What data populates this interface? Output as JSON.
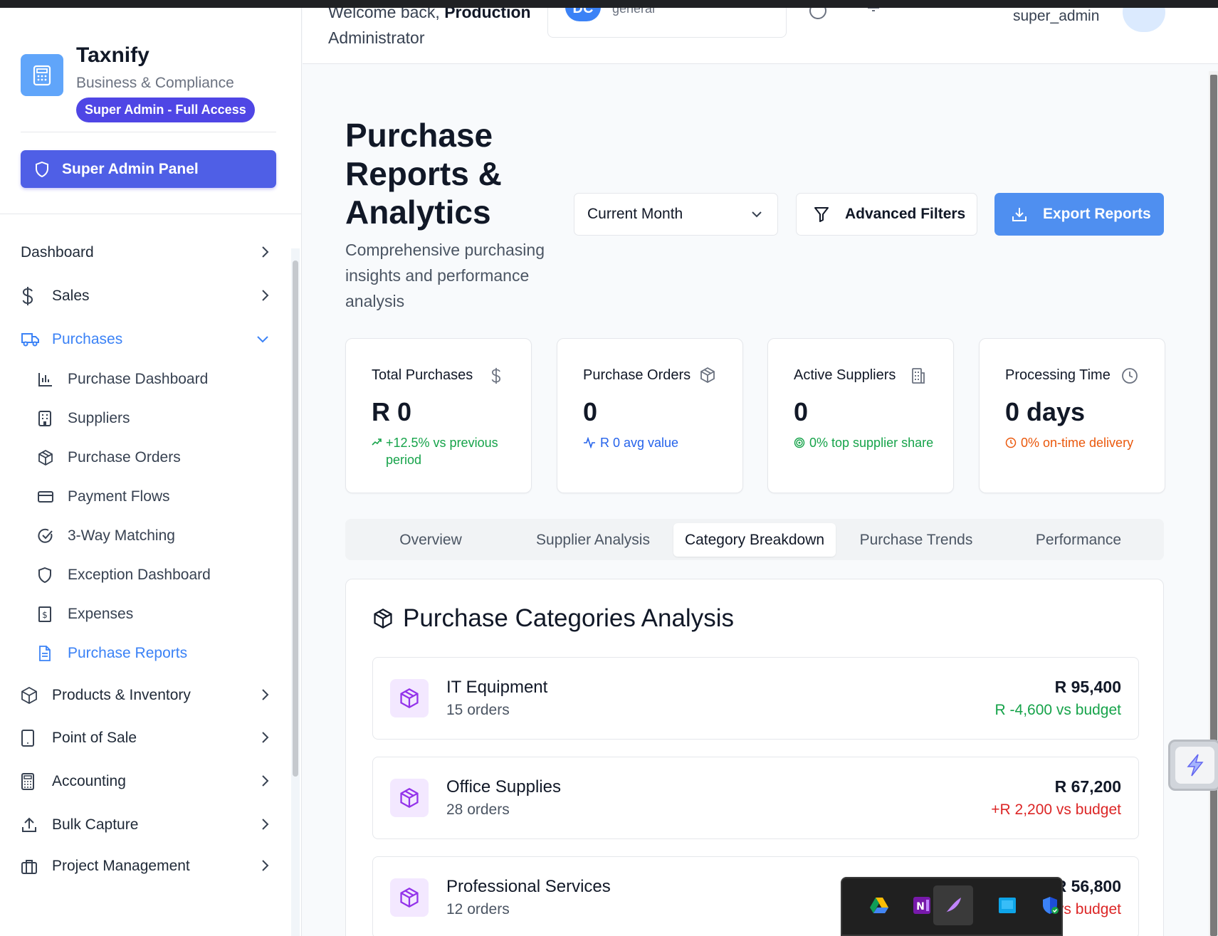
{
  "app": {
    "name": "Taxnify",
    "subtitle": "Business & Compliance",
    "role_badge": "Super Admin - Full Access",
    "admin_panel_label": "Super Admin Panel"
  },
  "header": {
    "welcome_prefix": "Welcome back,",
    "welcome_name": "Production",
    "welcome_name_line2": "Administrator",
    "company_avatar": "DC",
    "company_name": "general",
    "user_name": "super_admin"
  },
  "sidebar": {
    "items": [
      {
        "label": "Dashboard",
        "icon": "none"
      },
      {
        "label": "Sales",
        "icon": "dollar-icon"
      },
      {
        "label": "Purchases",
        "icon": "truck-icon",
        "expanded": true
      },
      {
        "label": "Products & Inventory",
        "icon": "box-icon"
      },
      {
        "label": "Point of Sale",
        "icon": "tablet-icon"
      },
      {
        "label": "Accounting",
        "icon": "calculator-icon"
      },
      {
        "label": "Bulk Capture",
        "icon": "upload-icon"
      },
      {
        "label": "Project Management",
        "icon": "briefcase-icon"
      }
    ],
    "subitems": [
      {
        "label": "Purchase Dashboard",
        "icon": "bar-chart-icon"
      },
      {
        "label": "Suppliers",
        "icon": "building-icon"
      },
      {
        "label": "Purchase Orders",
        "icon": "package-icon"
      },
      {
        "label": "Payment Flows",
        "icon": "credit-card-icon"
      },
      {
        "label": "3-Way Matching",
        "icon": "check-circle-icon"
      },
      {
        "label": "Exception Dashboard",
        "icon": "shield-icon"
      },
      {
        "label": "Expenses",
        "icon": "receipt-icon"
      },
      {
        "label": "Purchase Reports",
        "icon": "file-text-icon",
        "active": true
      }
    ]
  },
  "page": {
    "title": "Purchase Reports & Analytics",
    "subtitle": "Comprehensive purchasing insights and performance analysis",
    "period_select": "Current Month",
    "filters_label": "Advanced Filters",
    "export_label": "Export Reports"
  },
  "stats": [
    {
      "label": "Total Purchases",
      "value": "R 0",
      "note": "+12.5% vs previous period",
      "color": "#16a34a",
      "icon": "dollar-icon"
    },
    {
      "label": "Purchase Orders",
      "value": "0",
      "note": "R 0 avg value",
      "color": "#2563eb",
      "icon": "package-icon"
    },
    {
      "label": "Active Suppliers",
      "value": "0",
      "note": "0% top supplier share",
      "color": "#16a34a",
      "icon": "building-icon"
    },
    {
      "label": "Processing Time",
      "value": "0 days",
      "note": "0% on-time delivery",
      "color": "#ea580c",
      "icon": "clock-icon"
    }
  ],
  "tabs": [
    "Overview",
    "Supplier Analysis",
    "Category Breakdown",
    "Purchase Trends",
    "Performance"
  ],
  "active_tab": "Category Breakdown",
  "categories_panel": {
    "title": "Purchase Categories Analysis",
    "rows": [
      {
        "name": "IT Equipment",
        "orders": "15 orders",
        "amount": "R 95,400",
        "budget": "R -4,600 vs budget",
        "budget_color": "#16a34a"
      },
      {
        "name": "Office Supplies",
        "orders": "28 orders",
        "amount": "R 67,200",
        "budget": "+R 2,200 vs budget",
        "budget_color": "#dc2626"
      },
      {
        "name": "Professional Services",
        "orders": "12 orders",
        "amount": "R 56,800",
        "budget": "+R 1,800 vs budget",
        "budget_color": "#dc2626"
      }
    ]
  },
  "colors": {
    "accent": "#3b82f6",
    "brand_badge": "#4f46e5",
    "export": "#4f8ff0",
    "category_icon": "#9333ea"
  }
}
